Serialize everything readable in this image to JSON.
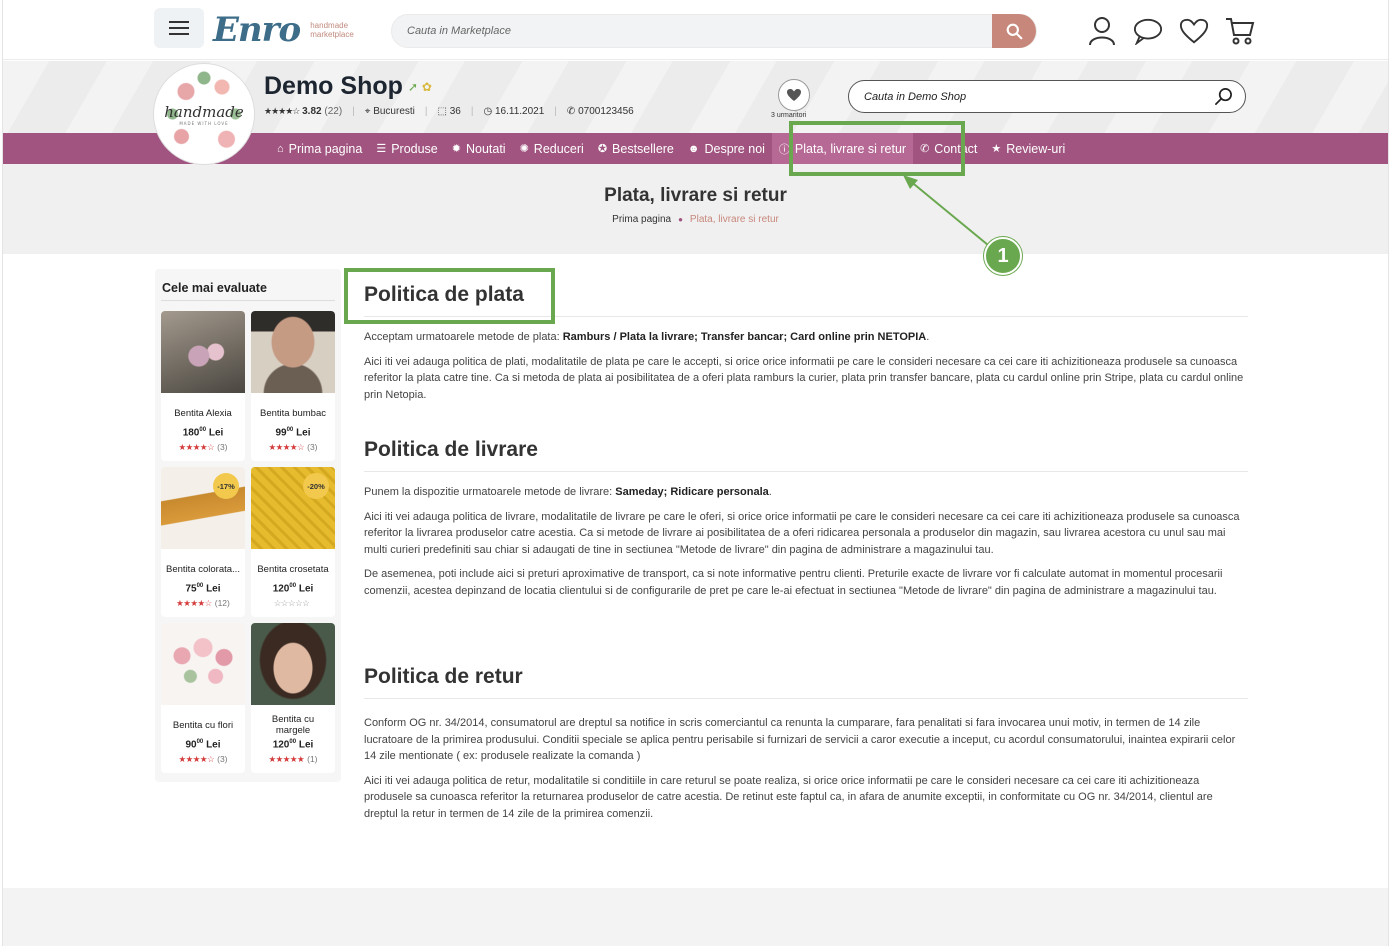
{
  "brand": {
    "logo_text": "Enro",
    "logo_sub_line1": "handmade",
    "logo_sub_line2": "marketplace",
    "accent": "#a0547f",
    "search_btn_color": "#c7877b",
    "highlight_color": "#6aa84f"
  },
  "topbar": {
    "search_placeholder": "Cauta in Marketplace",
    "icons": [
      "user-icon",
      "chat-icon",
      "heart-icon",
      "cart-icon"
    ]
  },
  "shop": {
    "avatar_text": "handmade",
    "avatar_subtext": "MADE WITH LOVE",
    "name": "Demo Shop",
    "stars": "★★★★☆",
    "rating": "3.82",
    "reviews": "(22)",
    "location": "Bucuresti",
    "products_count": "36",
    "since": "16.11.2021",
    "phone": "0700123456",
    "followers": "3 urmaritori",
    "search_placeholder": "Cauta in Demo Shop"
  },
  "nav": {
    "items": [
      {
        "label": "Prima pagina",
        "icon": "home-icon"
      },
      {
        "label": "Produse",
        "icon": "list-icon"
      },
      {
        "label": "Noutati",
        "icon": "badge-new-icon"
      },
      {
        "label": "Reduceri",
        "icon": "percent-icon"
      },
      {
        "label": "Bestsellere",
        "icon": "award-icon"
      },
      {
        "label": "Despre noi",
        "icon": "user-circle-icon"
      },
      {
        "label": "Plata, livrare si retur",
        "icon": "info-icon"
      },
      {
        "label": "Contact",
        "icon": "phone-icon"
      },
      {
        "label": "Review-uri",
        "icon": "star-icon"
      }
    ],
    "active_index": 6
  },
  "page": {
    "title": "Plata, livrare si retur",
    "breadcrumb_home": "Prima pagina",
    "breadcrumb_current": "Plata, livrare si retur",
    "callout_number": "1"
  },
  "sidebar": {
    "title": "Cele mai evaluate",
    "products": [
      {
        "name": "Bentita Alexia",
        "price_int": "180",
        "price_dec": "00",
        "currency": "Lei",
        "stars": "★★★★☆",
        "count": "(3)",
        "discount": ""
      },
      {
        "name": "Bentita bumbac",
        "price_int": "99",
        "price_dec": "00",
        "currency": "Lei",
        "stars": "★★★★☆",
        "count": "(3)",
        "discount": ""
      },
      {
        "name": "Bentita colorata...",
        "price_int": "75",
        "price_dec": "00",
        "currency": "Lei",
        "stars": "★★★★☆",
        "count": "(12)",
        "discount": "-17%"
      },
      {
        "name": "Bentita crosetata",
        "price_int": "120",
        "price_dec": "00",
        "currency": "Lei",
        "stars": "☆☆☆☆☆",
        "count": "",
        "discount": "-20%"
      },
      {
        "name": "Bentita cu flori",
        "price_int": "90",
        "price_dec": "00",
        "currency": "Lei",
        "stars": "★★★★☆",
        "count": "(3)",
        "discount": ""
      },
      {
        "name": "Bentita cu margele",
        "price_int": "120",
        "price_dec": "00",
        "currency": "Lei",
        "stars": "★★★★★",
        "count": "(1)",
        "discount": ""
      }
    ]
  },
  "content": {
    "payment": {
      "heading": "Politica de plata",
      "intro": "Acceptam urmatoarele metode de plata: ",
      "methods": "Ramburs / Plata la livrare; Transfer bancar; Card online prin NETOPIA",
      "intro_end": ".",
      "p1": "Aici iti vei adauga politica de plati, modalitatile de plata pe care le accepti, si orice orice informatii pe care le consideri necesare ca cei care iti achizitioneaza produsele sa cunoasca referitor la plata catre tine. Ca si metoda de plata ai posibilitatea de a oferi plata ramburs la curier, plata prin transfer bancare, plata cu cardul online prin Stripe, plata cu cardul online prin Netopia."
    },
    "delivery": {
      "heading": "Politica de livrare",
      "intro": "Punem la dispozitie urmatoarele metode de livrare: ",
      "methods": "Sameday; Ridicare personala",
      "intro_end": ".",
      "p1": "Aici iti vei adauga politica de livrare, modalitatile de livrare pe care le oferi, si orice orice informatii pe care le consideri necesare ca cei care iti achizitioneaza produsele sa cunoasca referitor la livrarea produselor catre acestia. Ca si metode de livrare ai posibilitatea de a oferi ridicarea personala a produselor din magazin, sau livrarea acestora cu unul sau mai multi curieri predefiniti sau chiar si adaugati de tine in sectiunea \"Metode de livrare\" din pagina de administrare a magazinului tau.",
      "p2": "De asemenea, poti include aici si preturi aproximative de transport, ca si note informative pentru clienti. Preturile exacte de livrare vor fi calculate automat in momentul procesarii comenzii, acestea depinzand de locatia clientului si de configurarile de pret pe care le-ai efectuat in sectiunea \"Metode de livrare\" din pagina de administrare a magazinului tau."
    },
    "returns": {
      "heading": "Politica de retur",
      "p1": "Conform OG nr. 34/2014, consumatorul are dreptul sa notifice in scris comerciantul ca renunta la cumparare, fara penalitati si fara invocarea unui motiv, in termen de 14 zile lucratoare de la primirea produsului. Conditii speciale se aplica pentru perisabile si furnizari de servicii a caror executie a inceput, cu acordul consumatorului, inaintea expirarii celor 14 zile mentionate ( ex: produsele realizate la comanda )",
      "p2": "Aici iti vei adauga politica de retur, modalitatile si conditiile in care returul se poate realiza, si orice orice informatii pe care le consideri necesare ca cei care iti achizitioneaza produsele sa cunoasca referitor la returnarea produselor de catre acestia. De retinut este faptul ca, in afara de anumite exceptii, in conformitate cu OG nr. 34/2014, clientul are dreptul la retur in termen de 14 zile de la primirea comenzii."
    }
  }
}
